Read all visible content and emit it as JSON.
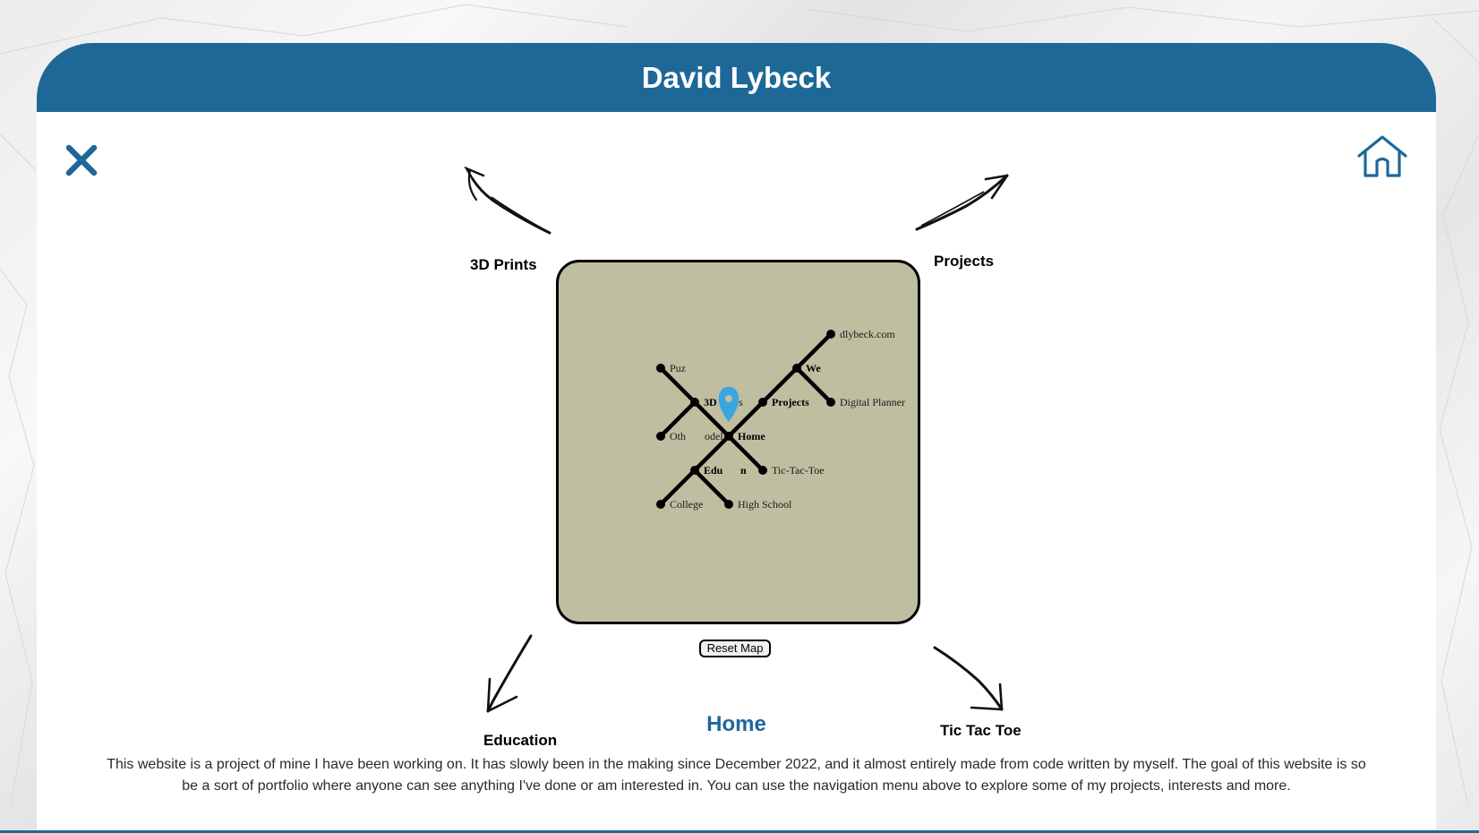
{
  "header": {
    "title": "David Lybeck"
  },
  "toolbar": {
    "close_icon": "close-icon",
    "home_icon": "home-icon"
  },
  "nav": {
    "prints_label": "3D Prints",
    "projects_label": "Projects",
    "education_label": "Education",
    "tictactoe_label": "Tic Tac Toe"
  },
  "map": {
    "background": "#bfbea0",
    "marker_color": "#3aa5e0",
    "nodes": {
      "dlybeck": "dlybeck.com",
      "puz": "Puz",
      "web": "We",
      "three_d": "3D",
      "s_frag": "s",
      "projects": "Projects",
      "digital_planner": "Digital Planner",
      "oth": "Oth",
      "models_frag": "odel",
      "home": "Home",
      "edu": "Edu",
      "n_frag": "n",
      "tictactoe": "Tic-Tac-Toe",
      "college": "College",
      "high_school": "High School"
    },
    "reset_label": "Reset Map"
  },
  "page": {
    "heading": "Home",
    "intro": "This website is a project of mine I have been working on. It has slowly been in the making since December 2022, and it almost entirely made from code written by myself. The goal of this website is so be a sort of portfolio where anyone can see anything I've done or am interested in. You can use the navigation menu above to explore some of my projects, interests and more."
  },
  "colors": {
    "brand": "#1e6898",
    "header_text": "#ffffff"
  }
}
